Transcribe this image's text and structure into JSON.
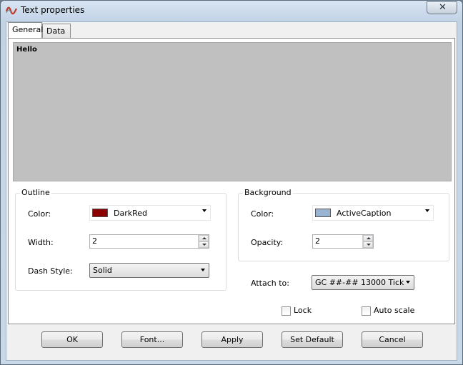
{
  "window": {
    "title": "Text properties",
    "close_icon": "close-icon"
  },
  "tabs": [
    {
      "label": "General",
      "active": true
    },
    {
      "label": "Data",
      "active": false
    }
  ],
  "preview": {
    "text": "Hello",
    "background": "#c0c0c0"
  },
  "outline": {
    "legend": "Outline",
    "color_label": "Color:",
    "color_value": "DarkRed",
    "color_hex": "#8b0000",
    "width_label": "Width:",
    "width_value": "2",
    "dash_label": "Dash Style:",
    "dash_value": "Solid"
  },
  "background": {
    "legend": "Background",
    "color_label": "Color:",
    "color_value": "ActiveCaption",
    "color_hex": "#99b4d1",
    "opacity_label": "Opacity:",
    "opacity_value": "2"
  },
  "attach": {
    "label": "Attach to:",
    "value": "GC ##-## 13000 Tick"
  },
  "checkboxes": {
    "lock": "Lock",
    "auto_scale": "Auto scale"
  },
  "buttons": {
    "ok": "OK",
    "font": "Font...",
    "apply": "Apply",
    "set_default": "Set Default",
    "cancel": "Cancel"
  }
}
